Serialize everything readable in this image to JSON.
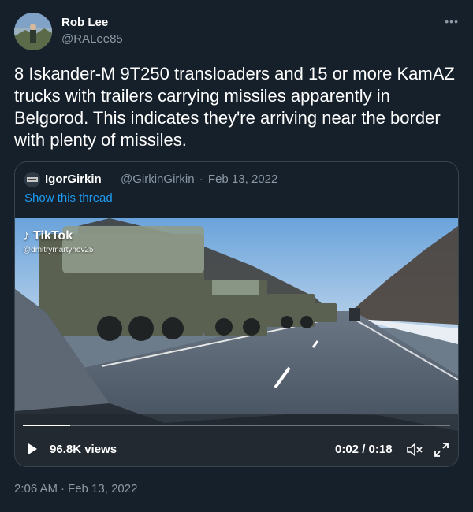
{
  "author": {
    "name": "Rob Lee",
    "handle": "@RALee85"
  },
  "more_icon": "ellipsis-icon",
  "tweet": {
    "text": "8 Iskander-M 9T250 transloaders and 15 or more KamAZ trucks with trailers carrying missiles apparently in Belgorod. This indicates they're arriving near the border with plenty of missiles."
  },
  "quote": {
    "name": "IgorGirkin",
    "handle": "@GirkinGirkin",
    "separator": "·",
    "date": "Feb 13, 2022",
    "show_thread": "Show this thread"
  },
  "video": {
    "watermark_brand": "TikTok",
    "watermark_user": "@dmitrymartynov25",
    "views": "96.8K views",
    "time": "0:02 / 0:18",
    "progress": 0.11
  },
  "timestamp": {
    "time": "2:06 AM",
    "separator": "·",
    "date": "Feb 13, 2022"
  },
  "colors": {
    "background": "#15202b",
    "primary_text": "#ffffff",
    "secondary_text": "#8b98a5",
    "link": "#1d9bf0",
    "border": "#38444d"
  }
}
